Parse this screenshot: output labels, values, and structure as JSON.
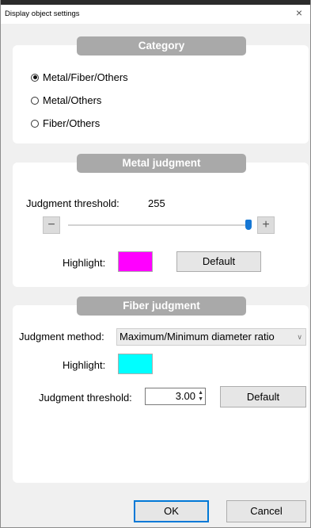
{
  "window": {
    "title": "Display object settings",
    "close_glyph": "×"
  },
  "category": {
    "header": "Category",
    "options": [
      {
        "label": "Metal/Fiber/Others",
        "selected": true
      },
      {
        "label": "Metal/Others",
        "selected": false
      },
      {
        "label": "Fiber/Others",
        "selected": false
      }
    ]
  },
  "metal": {
    "header": "Metal judgment",
    "threshold_label": "Judgment threshold:",
    "threshold_value": "255",
    "slider_value": 255,
    "slider_max": 255,
    "minus_glyph": "−",
    "plus_glyph": "+",
    "highlight_label": "Highlight:",
    "highlight_color": "#ff00ff",
    "default_label": "Default"
  },
  "fiber": {
    "header": "Fiber judgment",
    "method_label": "Judgment method:",
    "method_value": "Maximum/Minimum diameter ratio",
    "highlight_label": "Highlight:",
    "highlight_color": "#00ffff",
    "threshold_label": "Judgment threshold:",
    "threshold_value": "3.00",
    "default_label": "Default"
  },
  "footer": {
    "ok_label": "OK",
    "cancel_label": "Cancel"
  },
  "colors": {
    "header_bg": "#a9a9a9",
    "panel_bg": "#ffffff",
    "dialog_bg": "#f0f0f0",
    "slider_thumb": "#1677d4",
    "ok_border": "#0078d7"
  }
}
